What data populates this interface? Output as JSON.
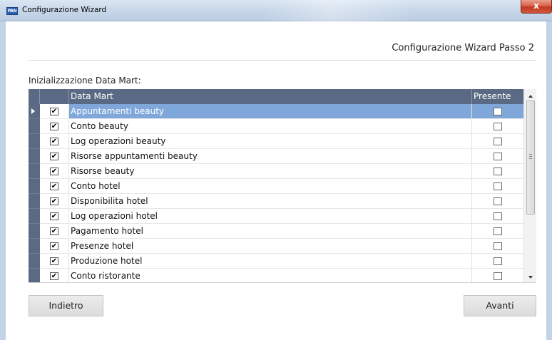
{
  "window": {
    "title": "Configurazione Wizard",
    "app_icon_text": "PAN",
    "close_label": "x",
    "icons": [
      "app-icon",
      "close-icon"
    ]
  },
  "wizard": {
    "step_title": "Configurazione Wizard Passo 2",
    "section_label": "Inizializzazione Data Mart:"
  },
  "grid": {
    "columns": {
      "name": "Data Mart",
      "present": "Presente"
    },
    "selected_index": 0,
    "rows": [
      {
        "name": "Appuntamenti beauty",
        "checked": true,
        "present": false
      },
      {
        "name": "Conto beauty",
        "checked": true,
        "present": false
      },
      {
        "name": "Log operazioni beauty",
        "checked": true,
        "present": false
      },
      {
        "name": "Risorse appuntamenti beauty",
        "checked": true,
        "present": false
      },
      {
        "name": "Risorse beauty",
        "checked": true,
        "present": false
      },
      {
        "name": "Conto hotel",
        "checked": true,
        "present": false
      },
      {
        "name": "Disponibilita hotel",
        "checked": true,
        "present": false
      },
      {
        "name": "Log operazioni hotel",
        "checked": true,
        "present": false
      },
      {
        "name": "Pagamento hotel",
        "checked": true,
        "present": false
      },
      {
        "name": "Presenze hotel",
        "checked": true,
        "present": false
      },
      {
        "name": "Produzione hotel",
        "checked": true,
        "present": false
      },
      {
        "name": "Conto ristorante",
        "checked": true,
        "present": false
      }
    ]
  },
  "buttons": {
    "back": "Indietro",
    "next": "Avanti"
  }
}
